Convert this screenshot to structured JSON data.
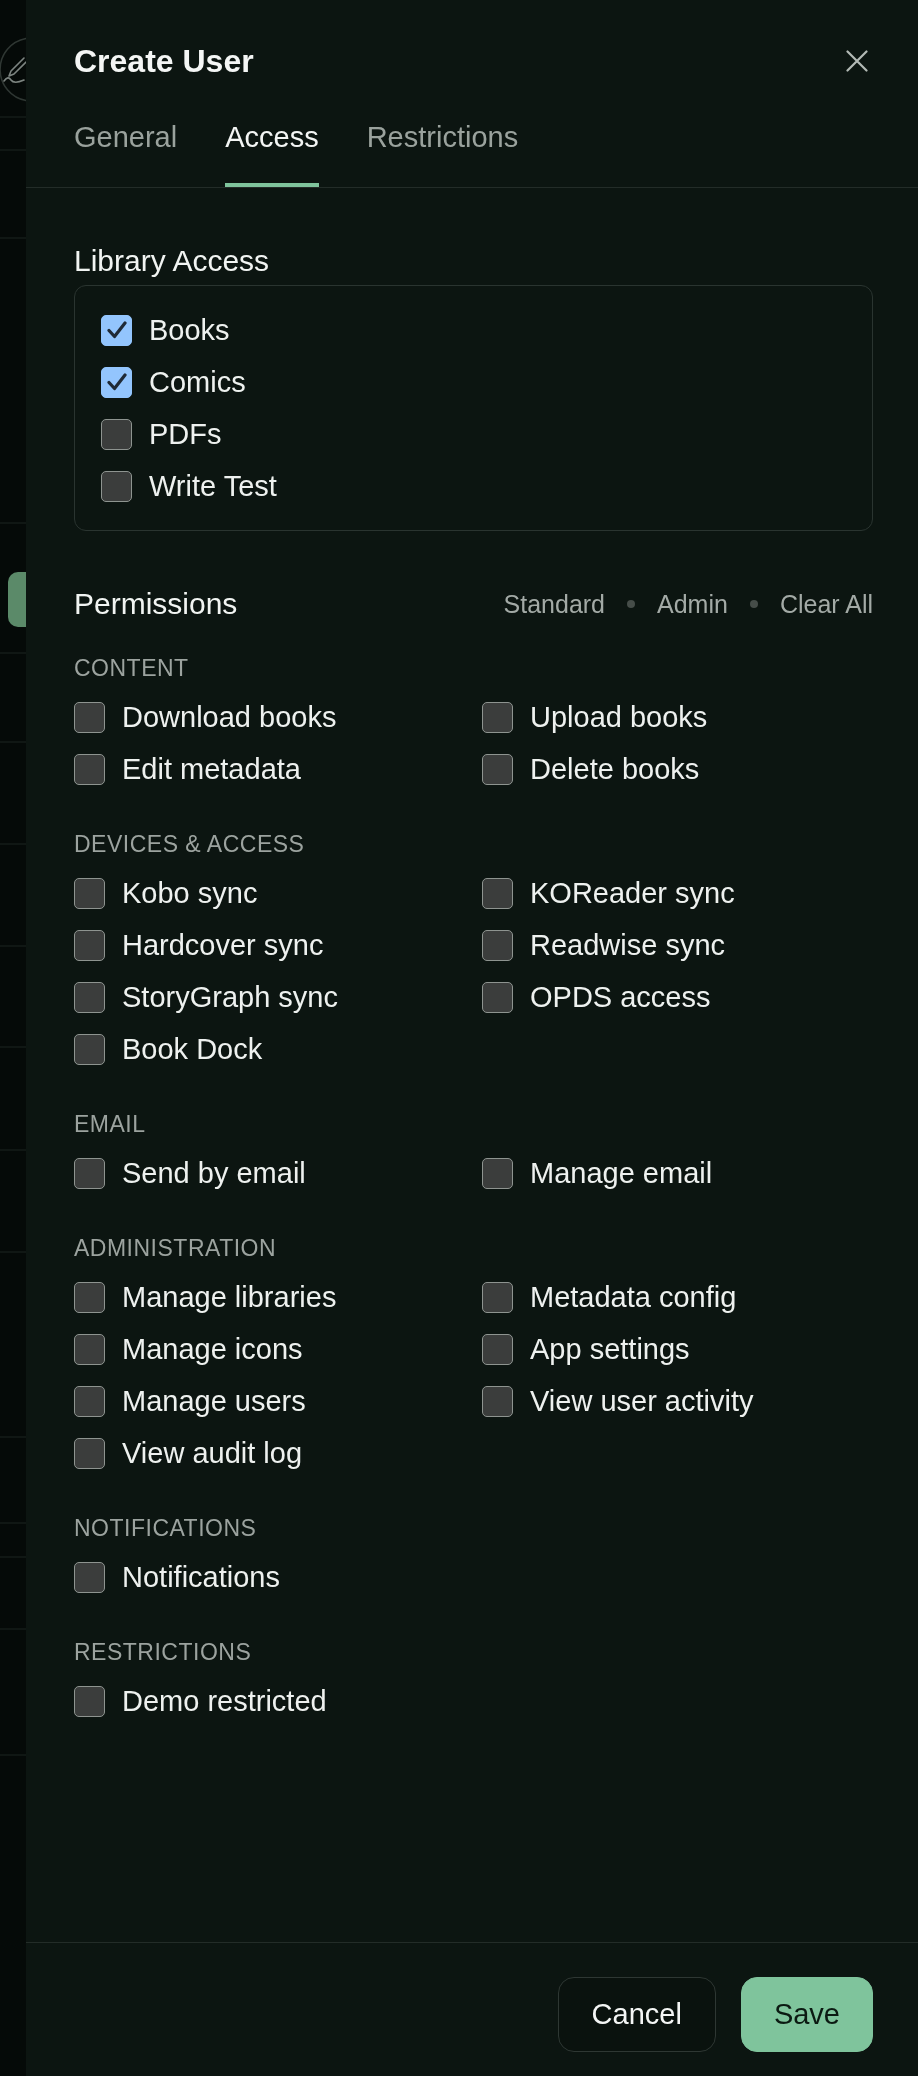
{
  "dialog": {
    "title": "Create User"
  },
  "tabs": [
    {
      "label": "General",
      "selected": false
    },
    {
      "label": "Access",
      "selected": true
    },
    {
      "label": "Restrictions",
      "selected": false
    }
  ],
  "library_access": {
    "title": "Library Access",
    "libraries": [
      {
        "label": "Books",
        "checked": true
      },
      {
        "label": "Comics",
        "checked": true
      },
      {
        "label": "PDFs",
        "checked": false
      },
      {
        "label": "Write Test",
        "checked": false
      }
    ]
  },
  "permissions": {
    "title": "Permissions",
    "presets": [
      "Standard",
      "Admin",
      "Clear All"
    ],
    "groups": [
      {
        "heading": "CONTENT",
        "items": [
          {
            "label": "Download books",
            "checked": false
          },
          {
            "label": "Upload books",
            "checked": false
          },
          {
            "label": "Edit metadata",
            "checked": false
          },
          {
            "label": "Delete books",
            "checked": false
          }
        ]
      },
      {
        "heading": "DEVICES & ACCESS",
        "items": [
          {
            "label": "Kobo sync",
            "checked": false
          },
          {
            "label": "KOReader sync",
            "checked": false
          },
          {
            "label": "Hardcover sync",
            "checked": false
          },
          {
            "label": "Readwise sync",
            "checked": false
          },
          {
            "label": "StoryGraph sync",
            "checked": false
          },
          {
            "label": "OPDS access",
            "checked": false
          },
          {
            "label": "Book Dock",
            "checked": false
          }
        ]
      },
      {
        "heading": "EMAIL",
        "items": [
          {
            "label": "Send by email",
            "checked": false
          },
          {
            "label": "Manage email",
            "checked": false
          }
        ]
      },
      {
        "heading": "ADMINISTRATION",
        "items": [
          {
            "label": "Manage libraries",
            "checked": false
          },
          {
            "label": "Metadata config",
            "checked": false
          },
          {
            "label": "Manage icons",
            "checked": false
          },
          {
            "label": "App settings",
            "checked": false
          },
          {
            "label": "Manage users",
            "checked": false
          },
          {
            "label": "View user activity",
            "checked": false
          },
          {
            "label": "View audit log",
            "checked": false
          }
        ]
      },
      {
        "heading": "NOTIFICATIONS",
        "items": [
          {
            "label": "Notifications",
            "checked": false
          }
        ]
      },
      {
        "heading": "RESTRICTIONS",
        "items": [
          {
            "label": "Demo restricted",
            "checked": false
          }
        ]
      }
    ]
  },
  "footer": {
    "buttons": [
      {
        "label": "Cancel",
        "kind": "secondary"
      },
      {
        "label": "Save",
        "kind": "primary"
      }
    ]
  }
}
